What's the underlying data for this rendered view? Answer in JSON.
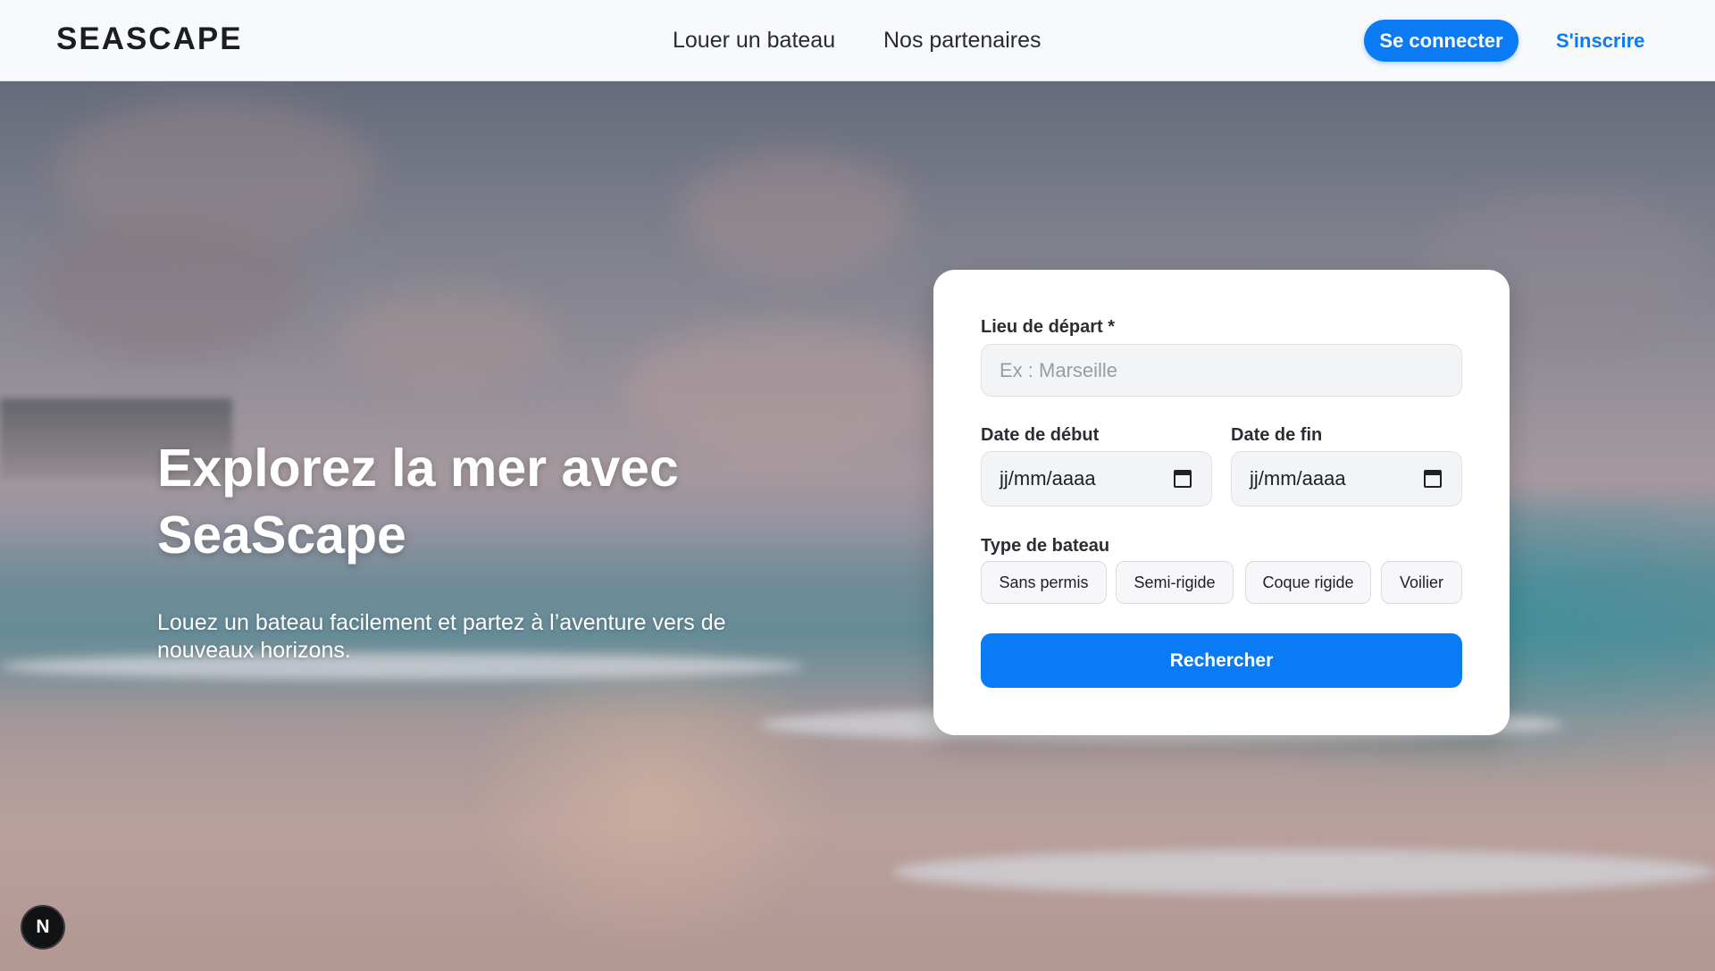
{
  "header": {
    "logo": "SEASCAPE",
    "nav": {
      "rent": "Louer un bateau",
      "partners": "Nos partenaires"
    },
    "login_label": "Se connecter",
    "signup_label": "S'inscrire"
  },
  "hero": {
    "title": "Explorez la mer avec SeaScape",
    "subtitle": "Louez un bateau facilement et partez à l’aventure vers de nouveaux horizons."
  },
  "search": {
    "departure_label": "Lieu de départ *",
    "departure_placeholder": "Ex : Marseille",
    "start_date_label": "Date de début",
    "start_date_value": "jj/mm/aaaa",
    "end_date_label": "Date de fin",
    "end_date_value": "jj/mm/aaaa",
    "boat_type_label": "Type de bateau",
    "boat_types": [
      "Sans permis",
      "Semi-rigide",
      "Coque rigide",
      "Voilier"
    ],
    "submit_label": "Rechercher"
  },
  "dev_badge": "N",
  "colors": {
    "accent": "#0b7bf5",
    "header_bg": "#f8f9fb",
    "card_bg": "#ffffff"
  }
}
